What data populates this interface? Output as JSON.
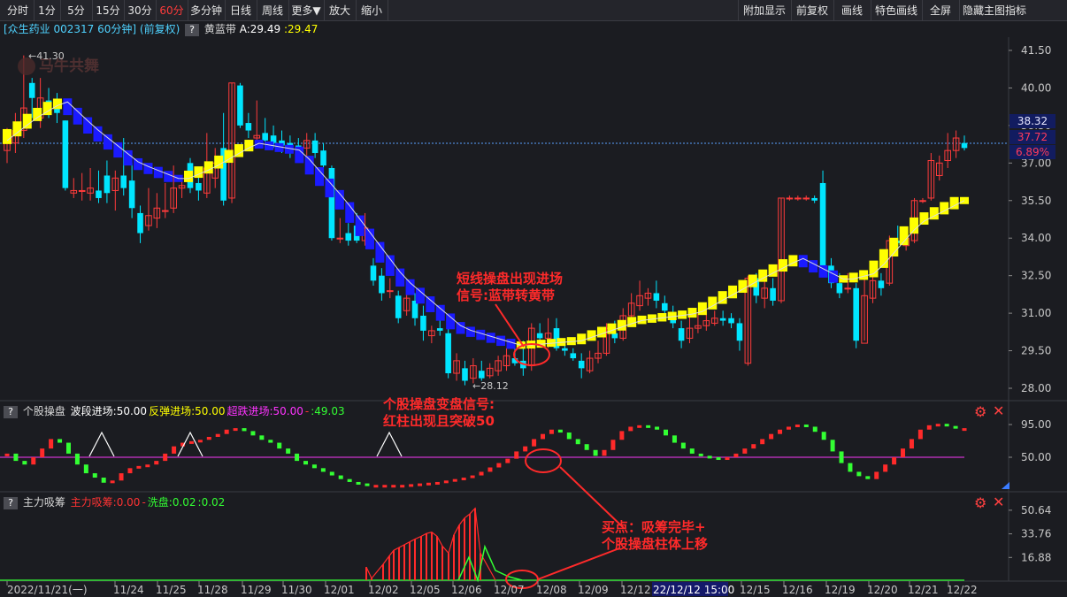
{
  "toolbar": {
    "left": [
      "分时",
      "1分",
      "5分",
      "15分",
      "30分",
      "60分",
      "多分钟",
      "日线",
      "周线",
      "更多▼",
      "放大",
      "缩小"
    ],
    "selected": "60分",
    "right": [
      "附加显示",
      "前复权",
      "画线",
      "特色画线",
      "全屏",
      "隐藏主图指标"
    ]
  },
  "main_header": {
    "stock": "[众生药业 002317 60分钟] (前复权)",
    "indicator": "黄蓝带",
    "a_label": "A:29.49",
    "value": ":29.47"
  },
  "watermark": "马牛共舞",
  "price_axis": [
    "41.50",
    "40.00",
    "38.50",
    "37.00",
    "35.50",
    "34.00",
    "32.50",
    "31.00",
    "29.50",
    "28.00"
  ],
  "price_tags": {
    "upper": "38.32",
    "current": "37.72",
    "change": "6.89%"
  },
  "extremes": {
    "high": "41.30",
    "low": "28.12"
  },
  "panel2": {
    "name": "个股操盘",
    "items": [
      {
        "text": "波段进场:50.00",
        "color": "#ffffff"
      },
      {
        "text": "反弹进场:50.00",
        "color": "#ffff00"
      },
      {
        "text": "超跌进场:50.00",
        "color": "#ff33ff"
      },
      {
        "text": "-",
        "color": "#ff3333"
      },
      {
        "text": ":49.03",
        "color": "#33ff33"
      }
    ],
    "axis": [
      "95.00",
      "50.00"
    ]
  },
  "panel3": {
    "name": "主力吸筹",
    "items": [
      {
        "text": "主力吸筹:0.00",
        "color": "#ff3333"
      },
      {
        "text": "-",
        "color": "#ff3333"
      },
      {
        "text": "洗盘:0.02",
        "color": "#33ff33"
      },
      {
        "text": ":0.02",
        "color": "#33ff33"
      }
    ],
    "axis": [
      "50.64",
      "33.76",
      "16.88"
    ]
  },
  "dates": [
    "2022/11/21(一)",
    "11/24",
    "11/25",
    "11/28",
    "11/29",
    "11/30",
    "12/01",
    "12/02",
    "12/05",
    "12/06",
    "12/07",
    "12/08",
    "12/09",
    "12/12",
    "22/12/12 15:00",
    "12/15",
    "12/16",
    "12/19",
    "12/20",
    "12/21",
    "12/22"
  ],
  "annotations": {
    "a1": [
      "短线操盘出现进场",
      "信号:蓝带转黄带"
    ],
    "a2": [
      "个股操盘变盘信号:",
      "红柱出现且突破50"
    ],
    "a3": [
      "买点：吸筹完毕+",
      "个股操盘柱体上移"
    ]
  }
}
